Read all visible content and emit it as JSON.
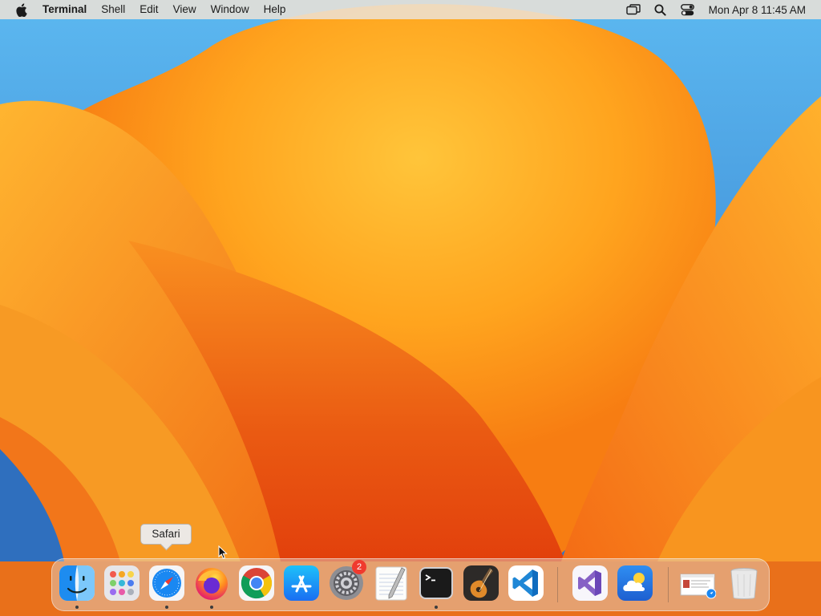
{
  "menubar": {
    "app_name": "Terminal",
    "menus": [
      "Shell",
      "Edit",
      "View",
      "Window",
      "Help"
    ],
    "clock": "Mon Apr 8  11:45 AM",
    "status_icons": [
      "screen-mirroring-icon",
      "spotlight-search-icon",
      "control-center-icon"
    ]
  },
  "tooltip": {
    "label": "Safari"
  },
  "dock": {
    "apps": [
      {
        "name": "Finder",
        "icon": "finder-icon",
        "running": true
      },
      {
        "name": "Launchpad",
        "icon": "launchpad-icon",
        "running": false
      },
      {
        "name": "Safari",
        "icon": "safari-icon",
        "running": true
      },
      {
        "name": "Firefox",
        "icon": "firefox-icon",
        "running": true
      },
      {
        "name": "Google Chrome",
        "icon": "chrome-icon",
        "running": false
      },
      {
        "name": "App Store",
        "icon": "app-store-icon",
        "running": false
      },
      {
        "name": "System Settings",
        "icon": "system-settings-icon",
        "running": false,
        "badge": "2"
      },
      {
        "name": "TextEdit",
        "icon": "textedit-icon",
        "running": false
      },
      {
        "name": "Terminal",
        "icon": "terminal-icon",
        "running": true
      },
      {
        "name": "GarageBand",
        "icon": "garageband-icon",
        "running": false
      },
      {
        "name": "Visual Studio Code",
        "icon": "vscode-icon",
        "running": false
      },
      {
        "name": "Visual Studio",
        "icon": "visual-studio-icon",
        "running": false
      },
      {
        "name": "Weather",
        "icon": "weather-icon",
        "running": false
      },
      {
        "name": "Downloads",
        "icon": "downloads-stack-icon",
        "running": false
      },
      {
        "name": "Trash",
        "icon": "trash-icon",
        "running": false
      }
    ]
  },
  "colors": {
    "wallpaper_orange": "#f7931e",
    "wallpaper_blue": "#3a8fd8",
    "badge_red": "#f03a2e"
  }
}
